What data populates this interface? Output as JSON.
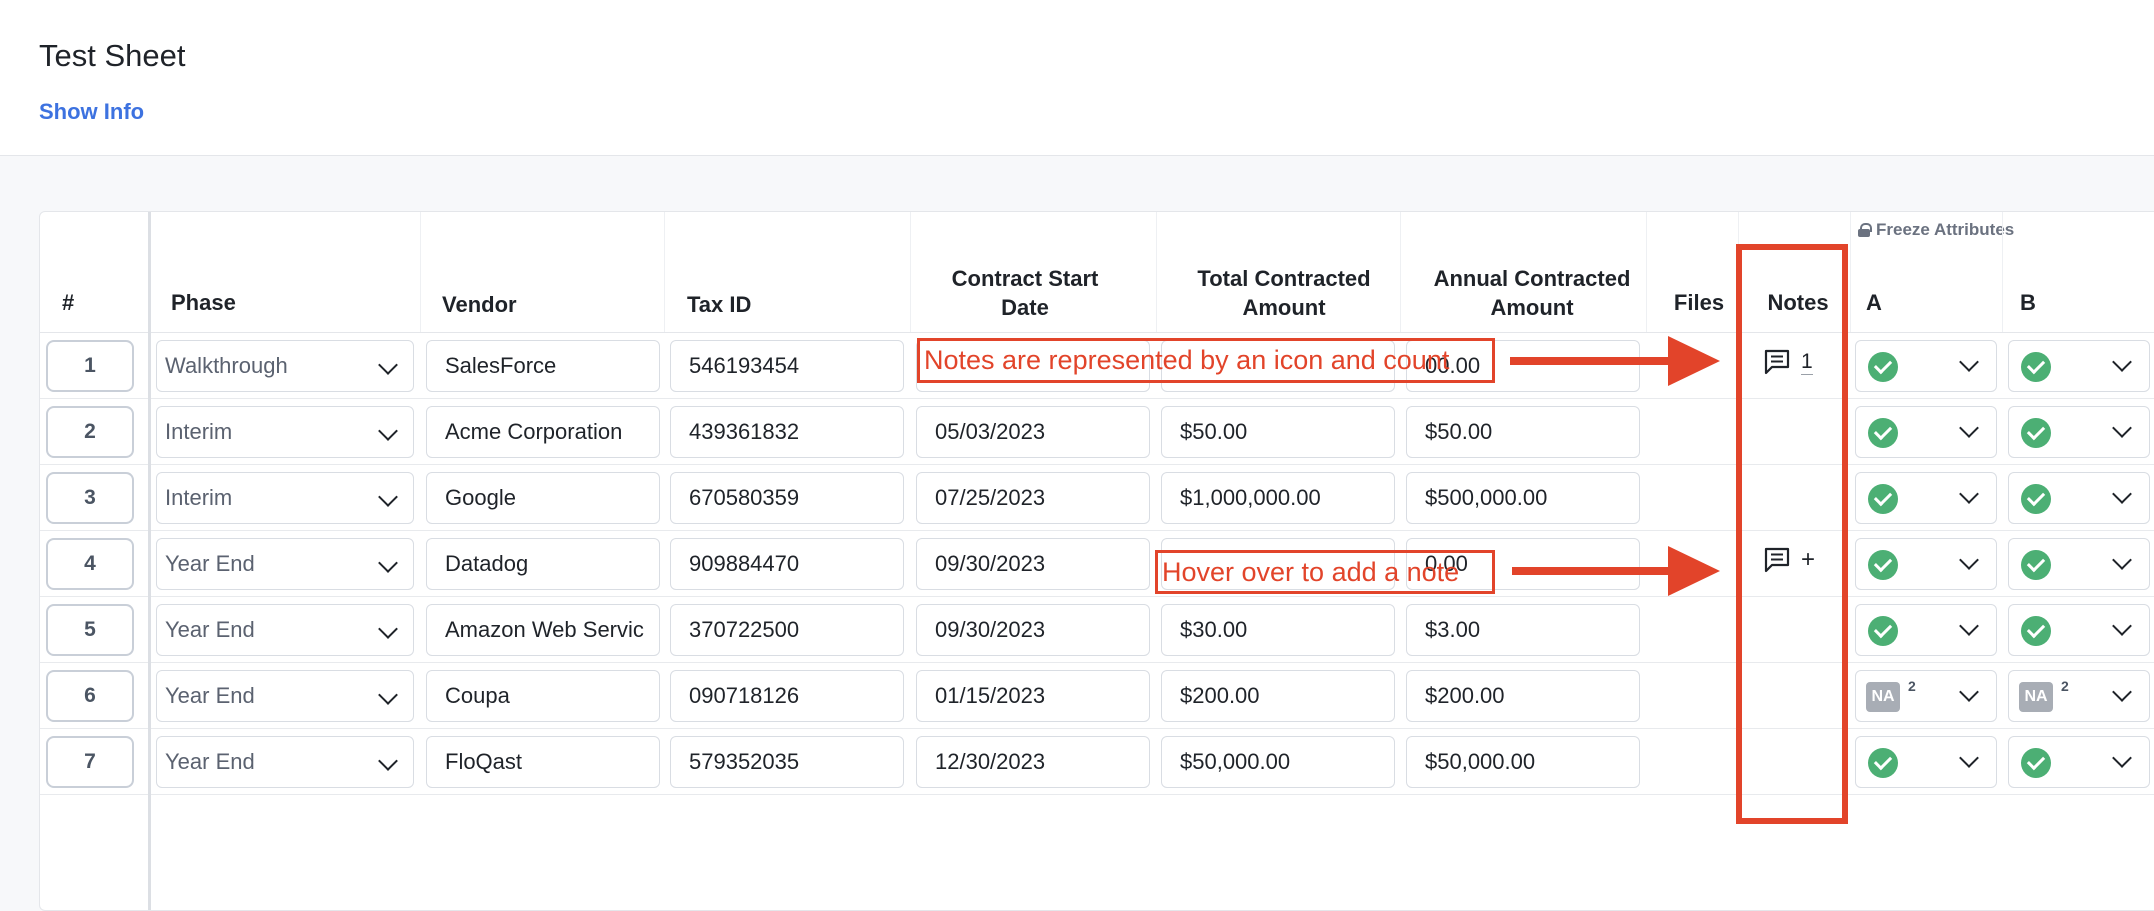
{
  "page": {
    "title": "Test Sheet",
    "show_info": "Show Info"
  },
  "table": {
    "freeze_label": "Freeze Attributes",
    "headers": {
      "num": "#",
      "phase": "Phase",
      "vendor": "Vendor",
      "tax_id": "Tax ID",
      "contract_start": "Contract Start Date",
      "total_contracted": "Total Contracted Amount",
      "annual_contracted": "Annual Contracted Amount",
      "files": "Files",
      "notes": "Notes",
      "a": "A",
      "b": "B"
    },
    "rows": [
      {
        "num": "1",
        "phase": "Walkthrough",
        "vendor": "SalesForce",
        "tax_id": "546193454",
        "start": "",
        "total": "",
        "annual": "00.00",
        "notes": "1",
        "a": "check",
        "b": "check"
      },
      {
        "num": "2",
        "phase": "Interim",
        "vendor": "Acme Corporation",
        "tax_id": "439361832",
        "start": "05/03/2023",
        "total": "$50.00",
        "annual": "$50.00",
        "notes": "",
        "a": "check",
        "b": "check"
      },
      {
        "num": "3",
        "phase": "Interim",
        "vendor": "Google",
        "tax_id": "670580359",
        "start": "07/25/2023",
        "total": "$1,000,000.00",
        "annual": "$500,000.00",
        "notes": "",
        "a": "check",
        "b": "check"
      },
      {
        "num": "4",
        "phase": "Year End",
        "vendor": "Datadog",
        "tax_id": "909884470",
        "start": "09/30/2023",
        "total": "",
        "annual": "0.00",
        "notes": "+",
        "a": "check",
        "b": "check"
      },
      {
        "num": "5",
        "phase": "Year End",
        "vendor": "Amazon Web Servic",
        "tax_id": "370722500",
        "start": "09/30/2023",
        "total": "$30.00",
        "annual": "$3.00",
        "notes": "",
        "a": "check",
        "b": "check"
      },
      {
        "num": "6",
        "phase": "Year End",
        "vendor": "Coupa",
        "tax_id": "090718126",
        "start": "01/15/2023",
        "total": "$200.00",
        "annual": "$200.00",
        "notes": "",
        "a": "NA",
        "a_count": "2",
        "b": "NA",
        "b_count": "2"
      },
      {
        "num": "7",
        "phase": "Year End",
        "vendor": "FloQast",
        "tax_id": "579352035",
        "start": "12/30/2023",
        "total": "$50,000.00",
        "annual": "$50,000.00",
        "notes": "",
        "a": "check",
        "b": "check"
      }
    ]
  },
  "annotations": {
    "notes_icon_count": "Notes are represented by an icon and count",
    "hover_add_note": "Hover over to add a note",
    "color": "#e2442a"
  },
  "icons": {
    "note": "comment-icon",
    "check": "check-circle-icon",
    "chevron": "chevron-down-icon",
    "lock": "lock-icon"
  }
}
